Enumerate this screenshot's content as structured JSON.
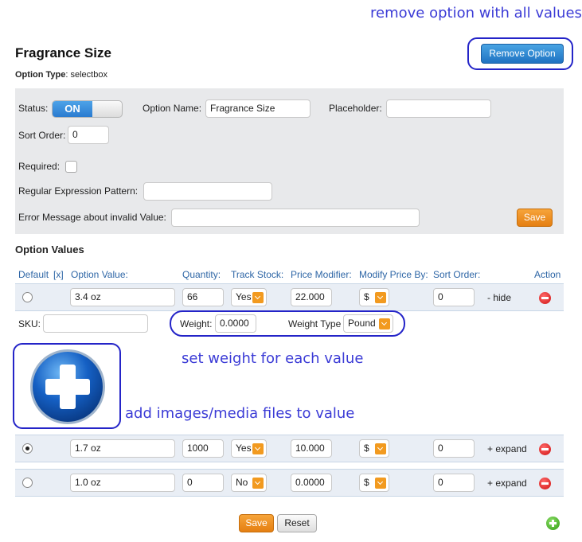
{
  "annotations": {
    "remove_option": "remove option with all values",
    "set_weight": "set weight for each value",
    "add_images": "add images/media files to value"
  },
  "header": {
    "title": "Fragrance Size",
    "option_type_label": "Option Type",
    "option_type_value": ": selectbox",
    "remove_button": "Remove Option"
  },
  "option_form": {
    "status_label": "Status:",
    "status_value": "ON",
    "option_name_label": "Option Name:",
    "option_name_value": "Fragrance Size",
    "placeholder_label": "Placeholder:",
    "placeholder_value": "",
    "sort_order_label": "Sort Order:",
    "sort_order_value": "0",
    "required_label": "Required:",
    "regex_label": "Regular Expression Pattern:",
    "regex_value": "",
    "error_label": "Error Message about invalid Value:",
    "error_value": "",
    "save_label": "Save"
  },
  "values_section": {
    "title": "Option Values",
    "columns": [
      "Default",
      "[x]",
      "Option Value:",
      "Quantity:",
      "Track Stock:",
      "Price Modifier:",
      "Modify Price By:",
      "Sort Order:",
      "Action"
    ],
    "rows": [
      {
        "value": "3.4 oz",
        "quantity": "66",
        "track": "Yes",
        "price": "22.000",
        "modify": "$",
        "sort": "0",
        "toggle": "- hide",
        "selected": false
      },
      {
        "value": "1.7 oz",
        "quantity": "1000",
        "track": "Yes",
        "price": "10.000",
        "modify": "$",
        "sort": "0",
        "toggle": "+ expand",
        "selected": true
      },
      {
        "value": "1.0 oz",
        "quantity": "0",
        "track": "No",
        "price": "0.0000",
        "modify": "$",
        "sort": "0",
        "toggle": "+ expand",
        "selected": false
      }
    ],
    "detail": {
      "sku_label": "SKU:",
      "sku_value": "",
      "weight_label": "Weight:",
      "weight_value": "0.0000",
      "weight_type_label": "Weight Type",
      "weight_type_value": "Pound"
    }
  },
  "footer": {
    "save_label": "Save",
    "reset_label": "Reset"
  },
  "colors": {
    "annotation": "#3b3bd6",
    "panel": "#e8e9eb",
    "header_text": "#2e66a6",
    "accent_orange": "#f29a1f",
    "accent_blue": "#1f73c2"
  },
  "icons": [
    "plus-image-icon",
    "delete-icon",
    "add-icon",
    "chevron-down-icon"
  ]
}
